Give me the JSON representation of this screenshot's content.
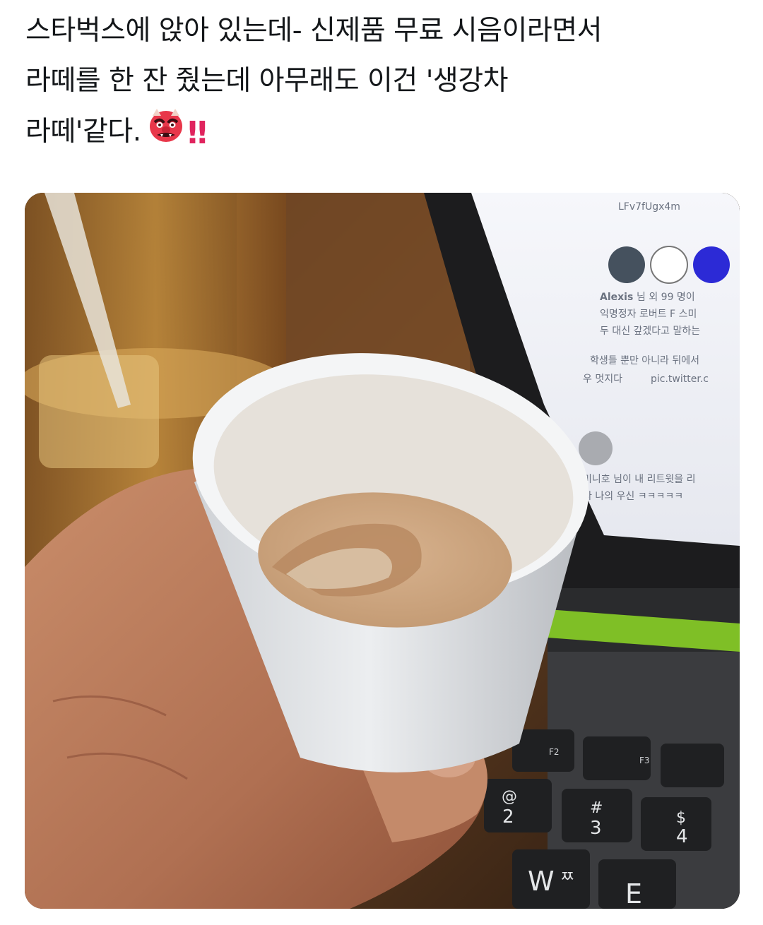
{
  "tweet": {
    "lines": [
      "스타벅스에 앉아 있는데- 신제품 무료 시음이라면서",
      "라떼를 한 잔 줬는데 아무래도 이건 '생강차",
      "라떼'같다."
    ],
    "emoji_icon": "goblin-mask-icon",
    "exclaim": "‼"
  },
  "photo": {
    "screen": {
      "url_text": "LFv7fUgx4m",
      "user_name": "Alexis",
      "line1": "님 외 99 명이",
      "line2": "익명정자 로버트 F 스미",
      "line3": "두 대신 갚겠다고 말하는",
      "line4": "학생들 뿐만 아니라 뒤에서",
      "line5": "우 멋지다",
      "link_text": "pic.twitter.c",
      "line6": "미니호 님이 내 리트윗을 리",
      "line7": "다 나의 우신 ㅋㅋㅋㅋㅋ"
    },
    "keyboard": {
      "keys": [
        "F2",
        "F3",
        "@",
        "2",
        "#",
        "3",
        "$",
        "4",
        "W",
        "ㅉ",
        "E"
      ]
    }
  }
}
